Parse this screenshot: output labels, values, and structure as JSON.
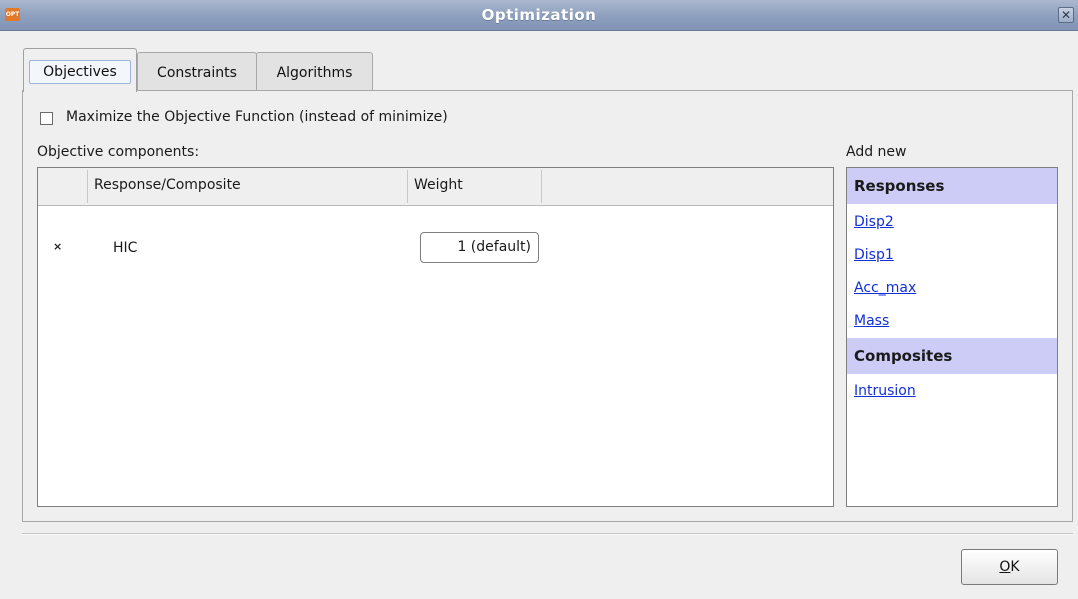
{
  "window": {
    "title": "Optimization",
    "app_icon_text": "OPT",
    "close_glyph": "✕"
  },
  "tabs": [
    {
      "label": "Objectives",
      "active": true
    },
    {
      "label": "Constraints",
      "active": false
    },
    {
      "label": "Algorithms",
      "active": false
    }
  ],
  "objectives": {
    "maximize_label": "Maximize the Objective Function (instead of minimize)",
    "maximize_checked": false,
    "components_label": "Objective components:",
    "columns": [
      "",
      "Response/Composite",
      "Weight",
      ""
    ],
    "rows": [
      {
        "remove_glyph": "×",
        "name": "HIC",
        "weight": "1 (default)"
      }
    ]
  },
  "add_new": {
    "label": "Add new",
    "sections": [
      {
        "title": "Responses",
        "items": [
          "Disp2",
          "Disp1",
          "Acc_max",
          "Mass"
        ]
      },
      {
        "title": "Composites",
        "items": [
          "Intrusion"
        ]
      }
    ]
  },
  "footer": {
    "ok_mnemonic": "O",
    "ok_rest": "K"
  }
}
